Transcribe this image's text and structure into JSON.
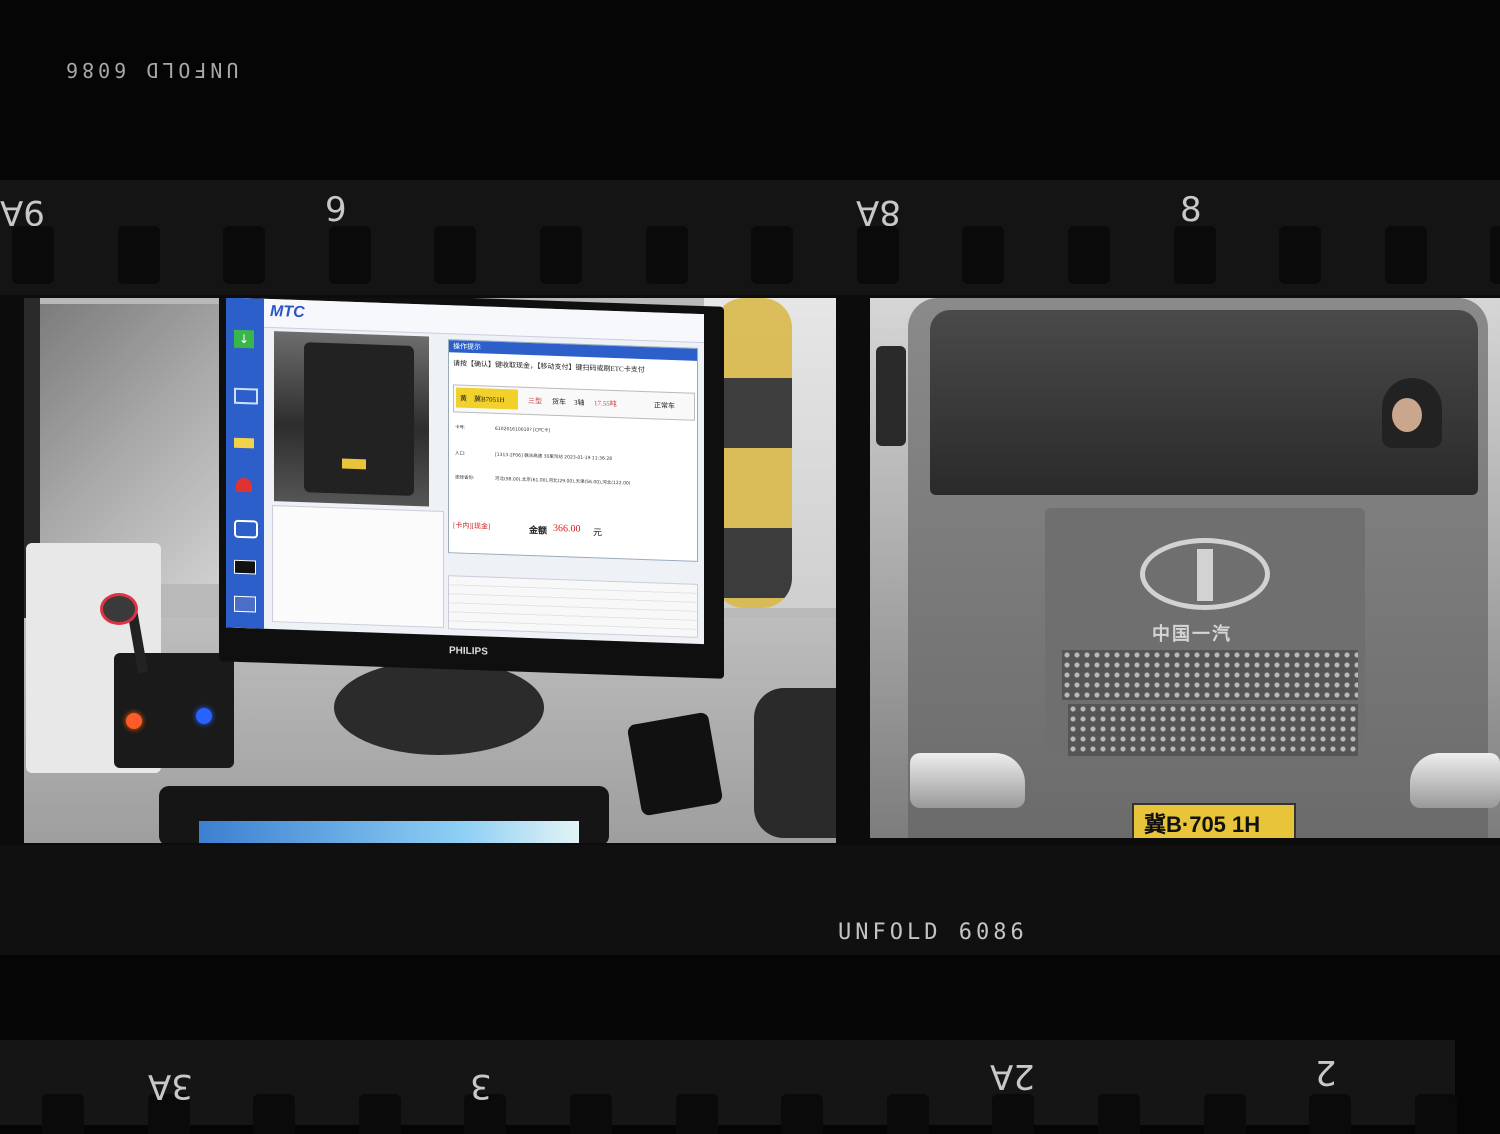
{
  "film": {
    "top_code": "UNFOLD 6086",
    "bottom_code": "UNFOLD 6086",
    "edge_top": [
      "9A",
      "9",
      "8A",
      "8"
    ],
    "edge_bottom": [
      "3A",
      "3",
      "2A",
      "2"
    ]
  },
  "monitor": {
    "brand": "PHILIPS",
    "app_logo": "MTC",
    "panel_title": "操作提示",
    "instruction": "请按【确认】键收取现金，【移动支付】键扫码或刷ETC卡支付",
    "plate_color": "黄",
    "plate": "冀B7051H",
    "vehicle_class": "三型",
    "vehicle_type": "货车",
    "axles": "3轴",
    "weight": "17.55吨",
    "status": "正常车",
    "card_label": "卡号:",
    "card_no": "610201610010? [CPC卡]",
    "entry_label": "入口:",
    "entry_value": "[1313-2F06] 赣冰高速 30里沟站 2023-01-19 11:36:28",
    "path_label": "途经省份:",
    "path_value": "河北(98.00),北京(61.00),河北(29.00),天津(56.00),河北(122.00)",
    "pay_mode": "[卡内][现金]",
    "amount_label": "金额",
    "amount": "366.00",
    "amount_unit": "元"
  },
  "truck": {
    "plate": "冀B·705 1H",
    "badge_text": "中国一汽"
  },
  "colors": {
    "film": "#050505",
    "screen_blue": "#2c5fc9",
    "amount_red": "#d42020",
    "plate_yellow": "#e8c43a"
  }
}
